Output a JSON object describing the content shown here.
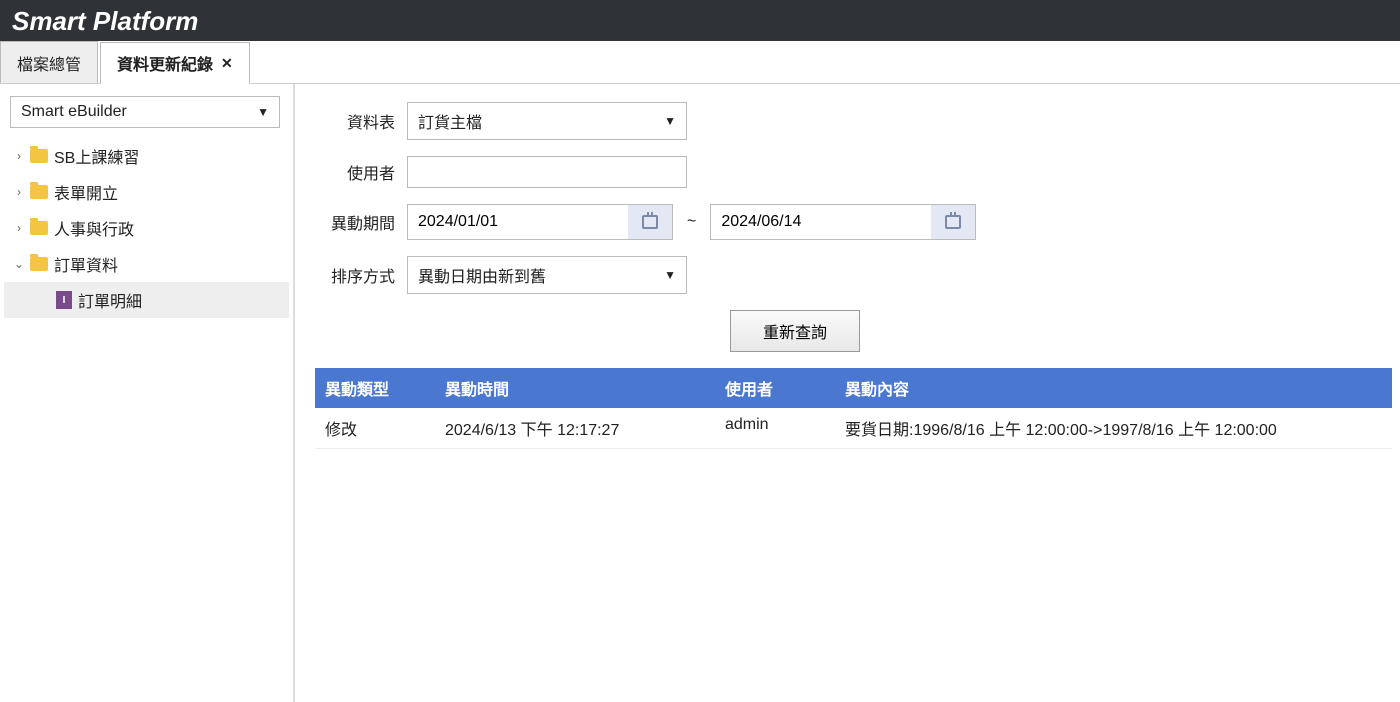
{
  "header": {
    "title": "Smart Platform"
  },
  "tabs": [
    {
      "label": "檔案總管",
      "active": false,
      "closable": false
    },
    {
      "label": "資料更新紀錄",
      "active": true,
      "closable": true
    }
  ],
  "sidebar": {
    "project": "Smart eBuilder",
    "nodes": [
      {
        "label": "SB上課練習",
        "expanded": false
      },
      {
        "label": "表單開立",
        "expanded": false
      },
      {
        "label": "人事與行政",
        "expanded": false
      },
      {
        "label": "訂單資料",
        "expanded": true,
        "children": [
          {
            "label": "訂單明細",
            "iconLetter": "I",
            "selected": true
          }
        ]
      }
    ]
  },
  "form": {
    "table_label": "資料表",
    "table_value": "訂貨主檔",
    "user_label": "使用者",
    "user_value": "",
    "period_label": "異動期間",
    "date_from": "2024/01/01",
    "date_to": "2024/06/14",
    "tilde": "~",
    "sort_label": "排序方式",
    "sort_value": "異動日期由新到舊",
    "requery": "重新查詢"
  },
  "grid": {
    "headers": {
      "type": "異動類型",
      "time": "異動時間",
      "user": "使用者",
      "content": "異動內容"
    },
    "rows": [
      {
        "type": "修改",
        "time": "2024/6/13 下午 12:17:27",
        "user": "admin",
        "content": "要貨日期:1996/8/16 上午 12:00:00->1997/8/16 上午 12:00:00"
      }
    ]
  }
}
